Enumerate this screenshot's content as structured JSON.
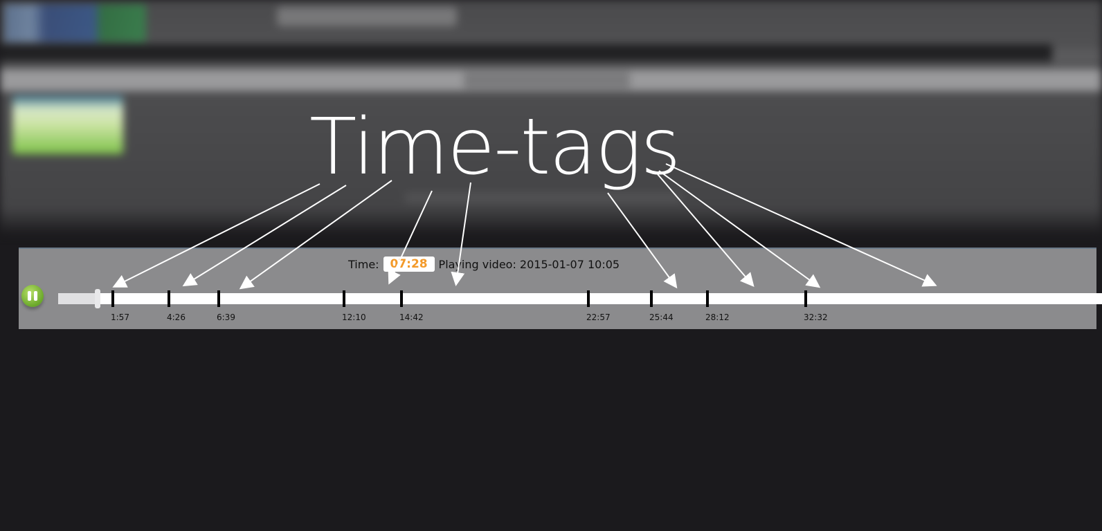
{
  "player": {
    "time_label": "Time:",
    "time_value": "07:28",
    "playing_text": "Playing video: 2015-01-07 10:05",
    "play_state": "pause-icon",
    "progress_fraction": 0.037,
    "accent_time_color": "#f39a2a"
  },
  "timeline": {
    "tags": [
      {
        "label": "1:57"
      },
      {
        "label": "4:26"
      },
      {
        "label": "6:39"
      },
      {
        "label": "12:10"
      },
      {
        "label": "14:42"
      },
      {
        "label": "22:57"
      },
      {
        "label": "25:44"
      },
      {
        "label": "28:12"
      },
      {
        "label": "32:32"
      }
    ]
  },
  "annotation": {
    "headline": "Time-tags"
  }
}
